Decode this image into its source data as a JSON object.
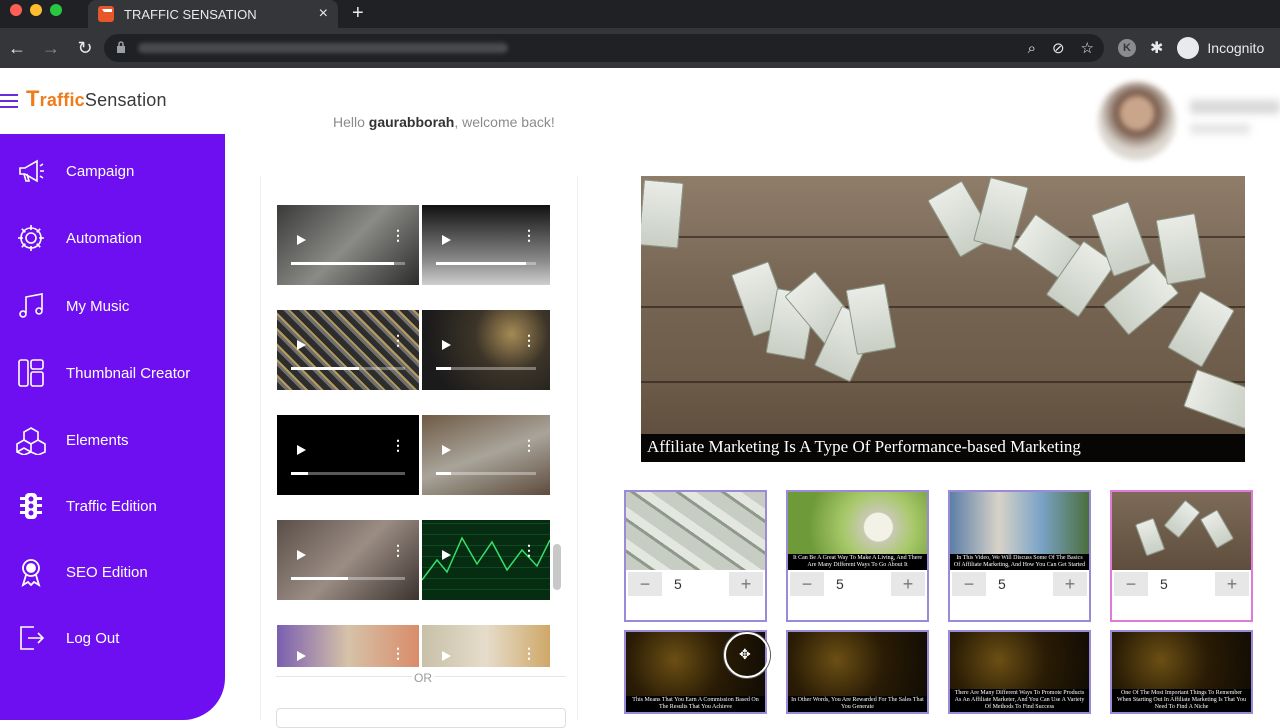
{
  "browser": {
    "tab_title": "TRAFFIC SENSATION",
    "close_glyph": "×",
    "newtab_glyph": "+",
    "profile": "Incognito",
    "extension_badge": "K",
    "dots": [
      "#ff5f57",
      "#febc2e",
      "#28c840"
    ]
  },
  "header": {
    "logo_t": "T",
    "logo_raffic": "raffic",
    "logo_sensation": "Sensation",
    "greeting_prefix": "Hello ",
    "username": "gaurabborah",
    "greeting_suffix": ", welcome back!"
  },
  "sidebar": {
    "items": [
      {
        "label": "Campaign",
        "icon": "megaphone-icon"
      },
      {
        "label": "Automation",
        "icon": "gear-icon"
      },
      {
        "label": "My Music",
        "icon": "music-note-icon"
      },
      {
        "label": "Thumbnail Creator",
        "icon": "layout-icon"
      },
      {
        "label": "Elements",
        "icon": "cubes-icon"
      },
      {
        "label": "Traffic Edition",
        "icon": "traffic-light-icon"
      },
      {
        "label": "SEO Edition",
        "icon": "award-icon"
      },
      {
        "label": "Log Out",
        "icon": "logout-icon"
      }
    ]
  },
  "video_list": {
    "or_label": "OR",
    "thumbnails": [
      {
        "progress": 0.9
      },
      {
        "progress": 0.9
      },
      {
        "progress": 0.6
      },
      {
        "progress": 0.15
      },
      {
        "progress": 0.15
      },
      {
        "progress": 0.15
      },
      {
        "progress": 0.5
      },
      {
        "progress": 0.0
      },
      {
        "progress": 0.0
      },
      {
        "progress": 0.0
      }
    ]
  },
  "preview": {
    "caption": "Affiliate Marketing Is A Type Of Performance-based Marketing"
  },
  "scenes": [
    {
      "caption": "",
      "quantity": "5",
      "minus": "−",
      "plus": "+"
    },
    {
      "caption": "It Can Be A Great Way To Make A Living, And There Are Many Different Ways To Go About It",
      "quantity": "5",
      "minus": "−",
      "plus": "+"
    },
    {
      "caption": "In This Video, We Will Discuss Some Of The Basics Of Affiliate Marketing, And How You Can Get Started",
      "quantity": "5",
      "minus": "−",
      "plus": "+"
    },
    {
      "caption": "",
      "quantity": "5",
      "minus": "−",
      "plus": "+"
    }
  ],
  "scenes_row2": [
    {
      "caption": "This Means That You Earn A Commission Based On The Results That You Achieve"
    },
    {
      "caption": "In Other Words, You Are Rewarded For The Sales That You Generate"
    },
    {
      "caption": "There Are Many Different Ways To Promote Products As An Affiliate Marketer, And You Can Use A Variety Of Methods To Find Success"
    },
    {
      "caption": "One Of The Most Important Things To Remember When Starting Out In Affiliate Marketing Is That You Need To Find A Niche"
    }
  ],
  "colors": {
    "sidebar": "#6d0ff0",
    "brand_orange": "#f07b1a",
    "card_border": "#9b8ad8",
    "card_selected": "#e07ad8"
  }
}
